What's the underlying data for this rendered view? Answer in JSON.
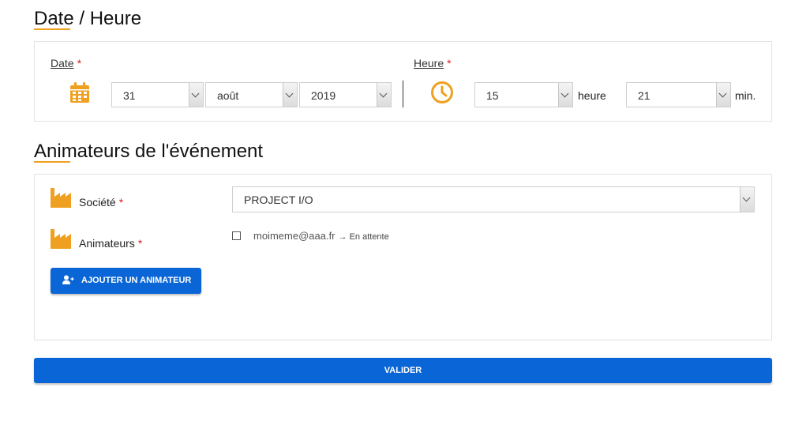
{
  "date_section": {
    "title": "Date / Heure",
    "date_label": "Date",
    "time_label": "Heure",
    "required_mark": "*",
    "day": "31",
    "month": "août",
    "year": "2019",
    "hour": "15",
    "hour_unit": "heure",
    "minute": "21",
    "minute_unit": "min."
  },
  "animators_section": {
    "title": "Animateurs de l'événement",
    "company_label": "Société",
    "animators_label": "Animateurs",
    "required_mark": "*",
    "company_value": "PROJECT I/O",
    "animators": [
      {
        "email": "moimeme@aaa.fr",
        "status": "→ En attente",
        "checked": false
      }
    ],
    "add_button_label": "AJOUTER UN ANIMATEUR"
  },
  "submit_label": "VALIDER",
  "colors": {
    "accent": "#f0a020",
    "primary": "#0a66d6",
    "required": "#e01e1e"
  }
}
